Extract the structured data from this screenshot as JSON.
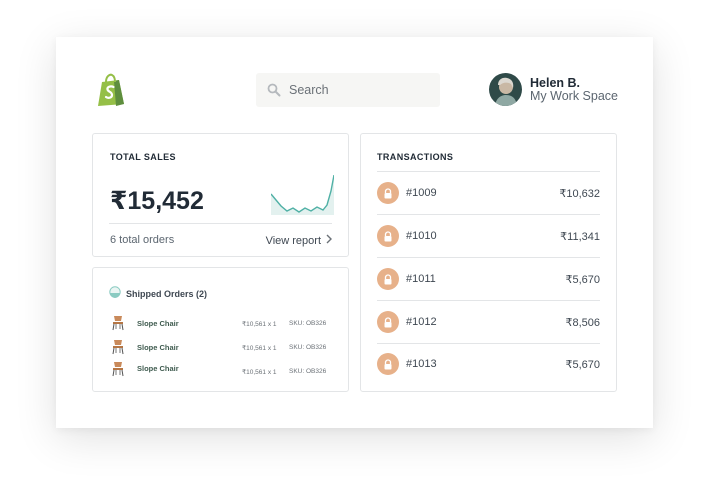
{
  "header": {
    "search_placeholder": "Search",
    "user": {
      "name": "Helen B.",
      "workspace": "My Work Space"
    }
  },
  "total_sales": {
    "title": "TOTAL SALES",
    "amount": "₹15,452",
    "orders": "6 total orders",
    "link": "View report"
  },
  "shipped": {
    "title": "Shipped Orders (2)",
    "items": [
      {
        "name": "Slope Chair",
        "price": "₹10,561 x 1",
        "sku": "SKU: OB326"
      },
      {
        "name": "Slope Chair",
        "price": "₹10,561 x 1",
        "sku": "SKU: OB326"
      },
      {
        "name": "Slope Chair",
        "price": "₹10,561 x 1",
        "sku": "SKU: OB326"
      }
    ]
  },
  "transactions": {
    "title": "TRANSACTIONS",
    "rows": [
      {
        "id": "#1009",
        "amount": "₹10,632"
      },
      {
        "id": "#1010",
        "amount": "₹11,341"
      },
      {
        "id": "#1011",
        "amount": "₹5,670"
      },
      {
        "id": "#1012",
        "amount": "₹8,506"
      },
      {
        "id": "#1013",
        "amount": "₹5,670"
      }
    ]
  },
  "colors": {
    "brand": "#95bf47",
    "accent": "#4fb0a5",
    "lock": "#e7b18a",
    "border": "#e3e5e7"
  },
  "icons": [
    "shopify-logo-icon",
    "search-icon",
    "chevron-right-icon",
    "lock-icon",
    "shipped-status-icon",
    "chair-icon"
  ]
}
